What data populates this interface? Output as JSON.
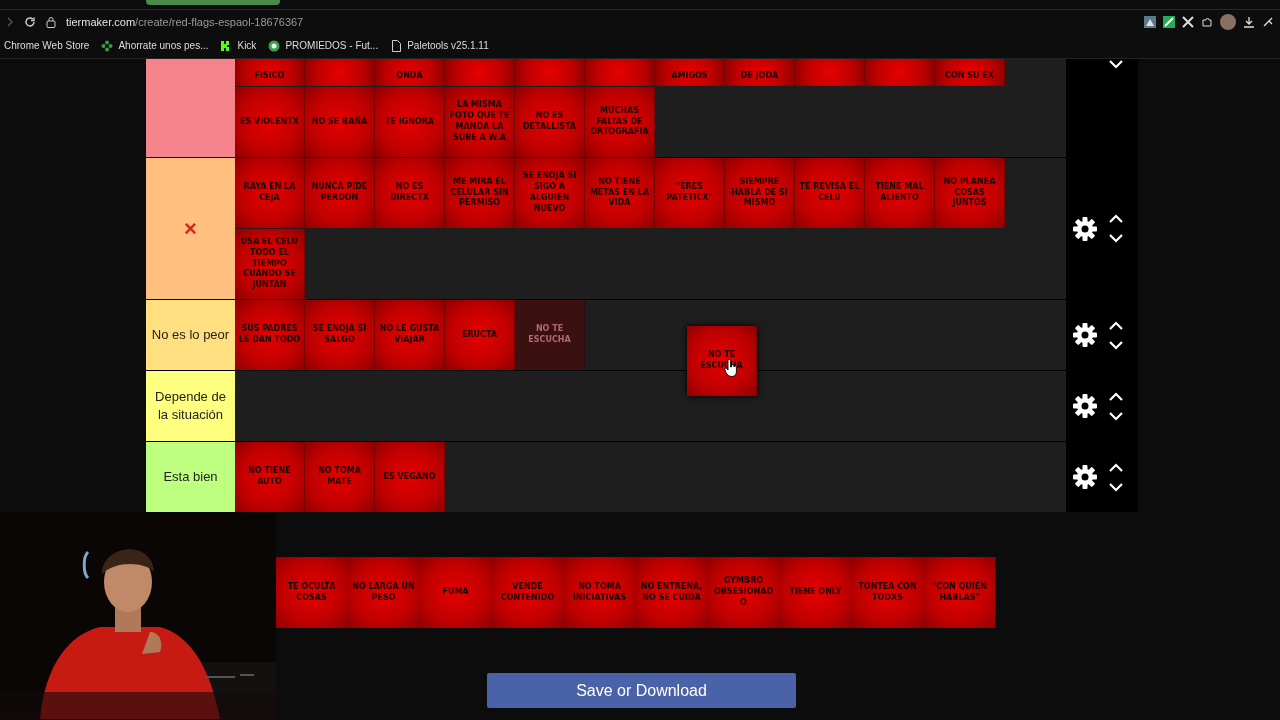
{
  "browser": {
    "url_domain": "tiermaker.com",
    "url_path": "/create/red-flags-espaol-18676367",
    "bookmarks": [
      {
        "label": "Chrome Web Store",
        "kind": "none"
      },
      {
        "label": "Ahorrate unos pes...",
        "kind": "dots"
      },
      {
        "label": "Kick",
        "kind": "square"
      },
      {
        "label": "PROMIEDOS - Fut...",
        "kind": "globe"
      },
      {
        "label": "Paletools v25.1.11",
        "kind": "page"
      }
    ]
  },
  "tiers": [
    {
      "color": "#f4838b",
      "kind": "cut",
      "lines": [
        [
          {
            "text": "FISICO",
            "kind": "cut"
          },
          {
            "kind": "cut"
          },
          {
            "text": "ONDA",
            "kind": "cut"
          },
          {
            "kind": "cut"
          },
          {
            "kind": "cut"
          },
          {
            "kind": "cut"
          },
          {
            "text": "AMIGOS",
            "kind": "cut"
          },
          {
            "text": "DE JODA",
            "kind": "cut"
          },
          {
            "kind": "cut"
          },
          {
            "kind": "cut"
          },
          {
            "text": "CON SU EX",
            "kind": "cut"
          }
        ],
        [
          {
            "text": "ES VIOLENTX",
            "kind": "full"
          },
          {
            "text": "NO SE BAÑA",
            "kind": "full"
          },
          {
            "text": "TE IGNORA",
            "kind": "full"
          },
          {
            "text": "LA MISMA FOTO QUE TE MANDA LA SUBE A W.A",
            "kind": "full"
          },
          {
            "text": "NO ES DETALLISTA",
            "kind": "full"
          },
          {
            "text": "MUCHAS FALTAS DE ORTOGRAFIA",
            "kind": "full"
          }
        ]
      ]
    },
    {
      "label": "×",
      "color": "#ffbf7f",
      "kind": "mark",
      "lines": [
        [
          {
            "text": "RAYA EN LA CEJA",
            "kind": "full"
          },
          {
            "text": "NUNCA PIDE PERDON",
            "kind": "full"
          },
          {
            "text": "NO ES DIRECTX",
            "kind": "full"
          },
          {
            "text": "ME MIRA EL CELULAR SIN PERMISO",
            "kind": "full"
          },
          {
            "text": "SE ENOJA SI SIGO A ALGUIEN NUEVO",
            "kind": "full"
          },
          {
            "text": "NO TIENE METAS EN LA VIDA",
            "kind": "full"
          },
          {
            "text": "\"ERES PATETICX\"",
            "kind": "full"
          },
          {
            "text": "SIEMPRE HABLA DE SI MISMO",
            "kind": "full"
          },
          {
            "text": "TE REVISA EL CELU",
            "kind": "full"
          },
          {
            "text": "TIENE MAL ALIENTO",
            "kind": "full"
          },
          {
            "text": "NO PLANEA COSAS JUNTOS",
            "kind": "full"
          }
        ],
        [
          {
            "text": "USA EL CELU TODO EL TIEMPO CUANDO SE JUNTAN",
            "kind": "full"
          }
        ]
      ]
    },
    {
      "label": "No es lo peor",
      "color": "#ffdf7f",
      "kind": "text",
      "lines": [
        [
          {
            "text": "SUS PADRES LE DAN TODO",
            "kind": "full"
          },
          {
            "text": "SE ENOJA SI SALGO",
            "kind": "full"
          },
          {
            "text": "NO LE GUSTA VIAJAR",
            "kind": "full"
          },
          {
            "text": "ERUCTA",
            "kind": "full"
          },
          {
            "text": "NO TE ESCUCHA",
            "kind": "ghost"
          }
        ]
      ]
    },
    {
      "label": "Depende de la situación",
      "color": "#ffff7f",
      "kind": "text"
    },
    {
      "label": "Esta bien",
      "color": "#bfff7f",
      "kind": "text",
      "lines": [
        [
          {
            "text": "NO TIENE AUTO",
            "kind": "full"
          },
          {
            "text": "NO TOMA MATE",
            "kind": "full"
          },
          {
            "text": "ES VEGANO",
            "kind": "full"
          }
        ]
      ]
    }
  ],
  "dragging": {
    "text": "NO TE ESCUCHA"
  },
  "pool": [
    {
      "text": "TE OCULTA COSAS"
    },
    {
      "text": "NO LARGA UN PESO"
    },
    {
      "text": "FUMA"
    },
    {
      "text": "VENDE CONTENIDO"
    },
    {
      "text": "NO TOMA INICIATIVAS"
    },
    {
      "text": "NO ENTRENA, NO SE CUIDA"
    },
    {
      "text": "GYMBRO OBSESIONADO"
    },
    {
      "text": "TIENE ONLY"
    },
    {
      "text": "TONTEA CON TODXS"
    },
    {
      "text": "\"CON QUIEN HABLAS\""
    }
  ],
  "save_button": "Save or Download"
}
